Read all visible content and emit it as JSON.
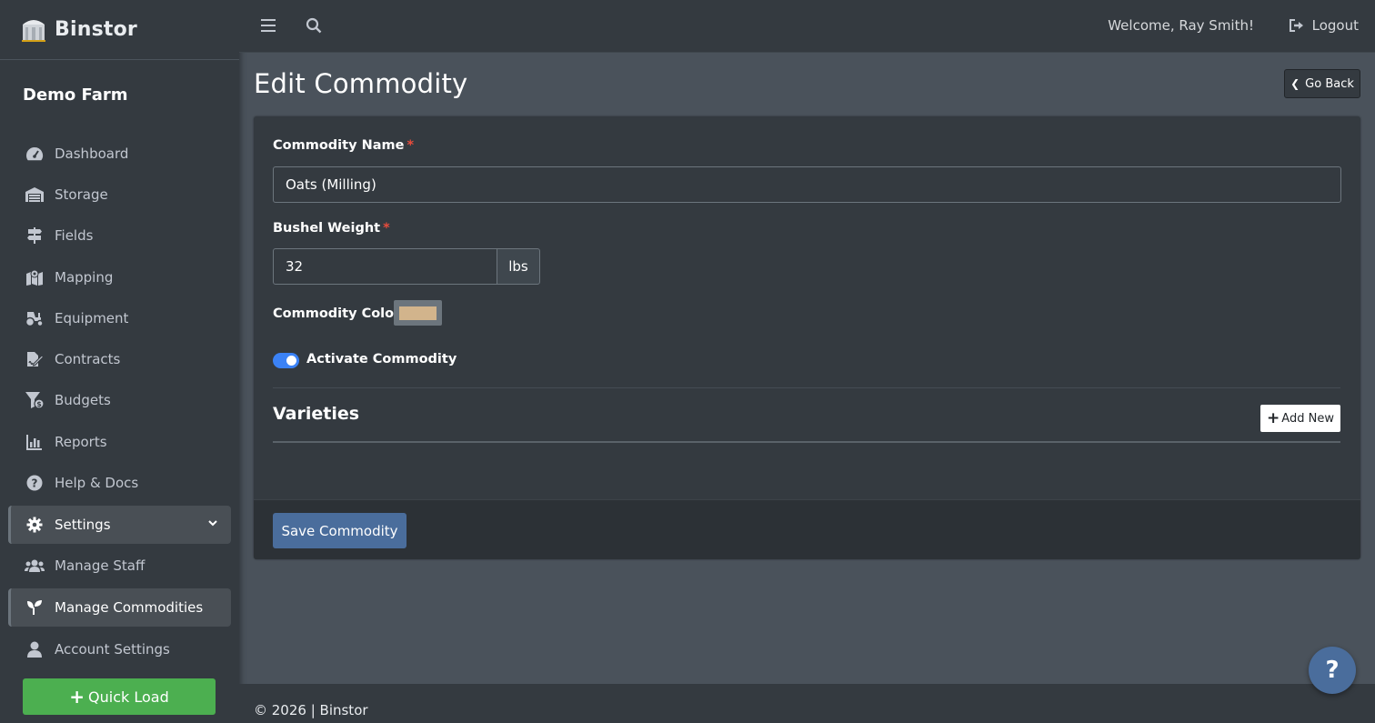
{
  "brand": {
    "name": "Binstor",
    "logo_icon": "silo-icon"
  },
  "sidebar": {
    "farm_name": "Demo Farm",
    "items": [
      {
        "label": "Dashboard",
        "icon": "gauge-icon"
      },
      {
        "label": "Storage",
        "icon": "warehouse-icon"
      },
      {
        "label": "Fields",
        "icon": "signpost-icon"
      },
      {
        "label": "Mapping",
        "icon": "map-marker-icon"
      },
      {
        "label": "Equipment",
        "icon": "tractor-icon"
      },
      {
        "label": "Contracts",
        "icon": "file-signature-icon"
      },
      {
        "label": "Budgets",
        "icon": "funnel-dollar-icon"
      },
      {
        "label": "Reports",
        "icon": "bar-chart-icon"
      },
      {
        "label": "Help & Docs",
        "icon": "question-circle-icon"
      },
      {
        "label": "Settings",
        "icon": "gear-icon"
      },
      {
        "label": "Manage Staff",
        "icon": "users-icon"
      },
      {
        "label": "Manage Commodities",
        "icon": "seedling-icon"
      },
      {
        "label": "Account Settings",
        "icon": "user-icon"
      }
    ],
    "quick_load": "Quick Load"
  },
  "topbar": {
    "welcome": "Welcome, Ray Smith!",
    "logout": "Logout"
  },
  "page": {
    "title": "Edit Commodity",
    "go_back": "Go Back"
  },
  "form": {
    "name_label": "Commodity Name",
    "name_value": "Oats (Milling)",
    "weight_label": "Bushel Weight",
    "weight_value": "32",
    "weight_unit": "lbs",
    "color_label": "Commodity Color",
    "color_value": "#d2b48c",
    "active_label": "Activate Commodity",
    "required_mark": "*",
    "varieties_title": "Varieties",
    "add_new": "Add New",
    "save": "Save Commodity"
  },
  "footer": {
    "text": "© 2026 | Binstor"
  },
  "help_fab": "?",
  "colors": {
    "accent": "#4a6d9c",
    "success": "#4caf50",
    "toggle": "#3b82f6",
    "required": "#e74c3c"
  }
}
